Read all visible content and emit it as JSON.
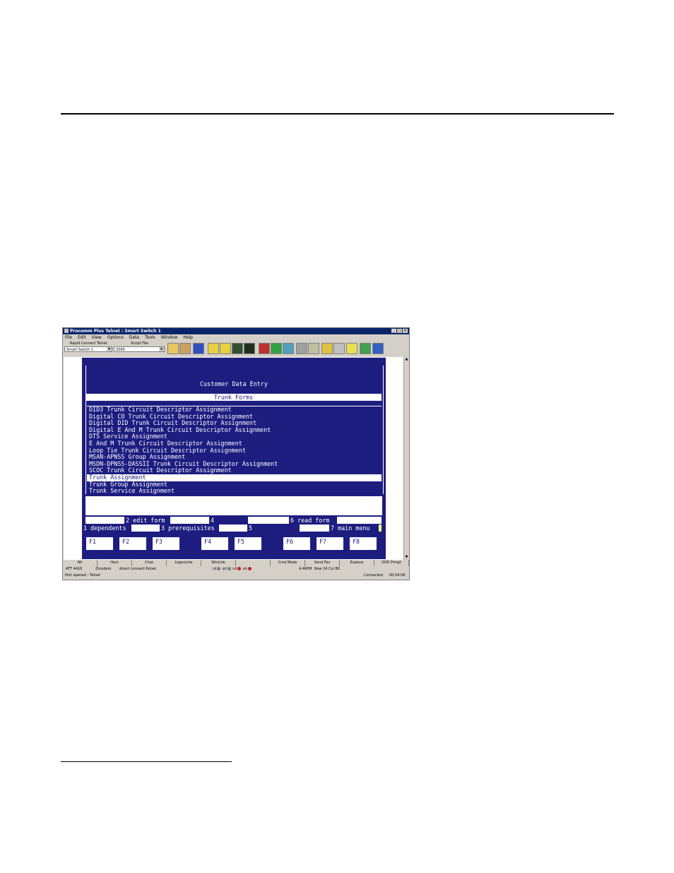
{
  "window": {
    "title": "Procomm Plus Telnet : Smart Switch 1",
    "controls": [
      "_",
      "□",
      "×"
    ]
  },
  "menu": [
    "File",
    "Edit",
    "View",
    "Options",
    "Data",
    "Tools",
    "Window",
    "Help"
  ],
  "toolbar": {
    "rapid_connect_label": "Rapid Connect Telnet",
    "rapid_connect_value": "Smart Switch 1",
    "script_file_label": "Script File:",
    "script_file_value": "2000"
  },
  "terminal": {
    "header": "Customer Data Entry",
    "section": "Trunk Forms",
    "items": [
      "DID3 Trunk Circuit Descriptor Assignment",
      "Digital CO Trunk Circuit Descriptor Assignment",
      "Digital DID Trunk Circuit Descriptor Assignment",
      "Digital E And M Trunk Circuit Descriptor Assignment",
      "DTS Service Assignment",
      "E And M Trunk Circuit Descriptor Assignment",
      "Loop Tie Trunk Circuit Descriptor Assignment",
      "MSAN-APNSS Group Assignment",
      "MSDN-DPNSS-DASSII Trunk Circuit Descriptor Assignment",
      "SCOC Trunk Circuit Descriptor Assignment",
      "Trunk Assignment",
      "Trunk Group Assignment",
      "Trunk Service Assignment"
    ],
    "softkeys_top": [
      "2 edit form",
      "4",
      "6 read form"
    ],
    "softkeys_bottom": [
      "1 dependents",
      "3 prerequisites",
      "5",
      "7 main menu"
    ],
    "fkeys": [
      "F1",
      "F2",
      "F3",
      "F4",
      "F5",
      "F6",
      "F7",
      "F8"
    ]
  },
  "taskbar": [
    "Alt",
    "Host",
    "Chat",
    "Logon/ute",
    "WinLink",
    "",
    "Cmd Mode",
    "Send Fax",
    "Explore",
    "DOS Prmpt"
  ],
  "status1": {
    "emulation": "ATT 4410",
    "modem": "Zmodem",
    "connection": "direct connect-Telnet",
    "leds": [
      "rd",
      "sd",
      "cd",
      "oh"
    ],
    "time": "4:46PM",
    "position": "Row 24   Col 80"
  },
  "status2": {
    "message": "Port opened - Telnet",
    "state": "Connected",
    "timer": "00:04:58"
  },
  "colors": {
    "terminal_bg": "#1d1d80",
    "title_bg": "#0a246a"
  }
}
